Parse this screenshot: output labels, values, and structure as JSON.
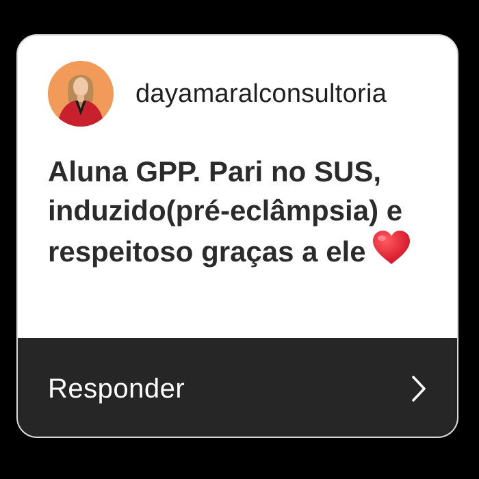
{
  "story_reply": {
    "username": "dayamaralconsultoria",
    "message": "Aluna GPP. Pari no SUS, induzido(pré-eclâmpsia) e respeitoso graças a ele",
    "emoji_icon": "red-heart-icon",
    "reply_label": "Responder",
    "reply_icon": "chevron-right-icon"
  },
  "colors": {
    "background": "#000000",
    "card": "#ffffff",
    "reply_bar": "#262626",
    "avatar_bg": "#f29a5a",
    "heart": "#e0142b"
  }
}
